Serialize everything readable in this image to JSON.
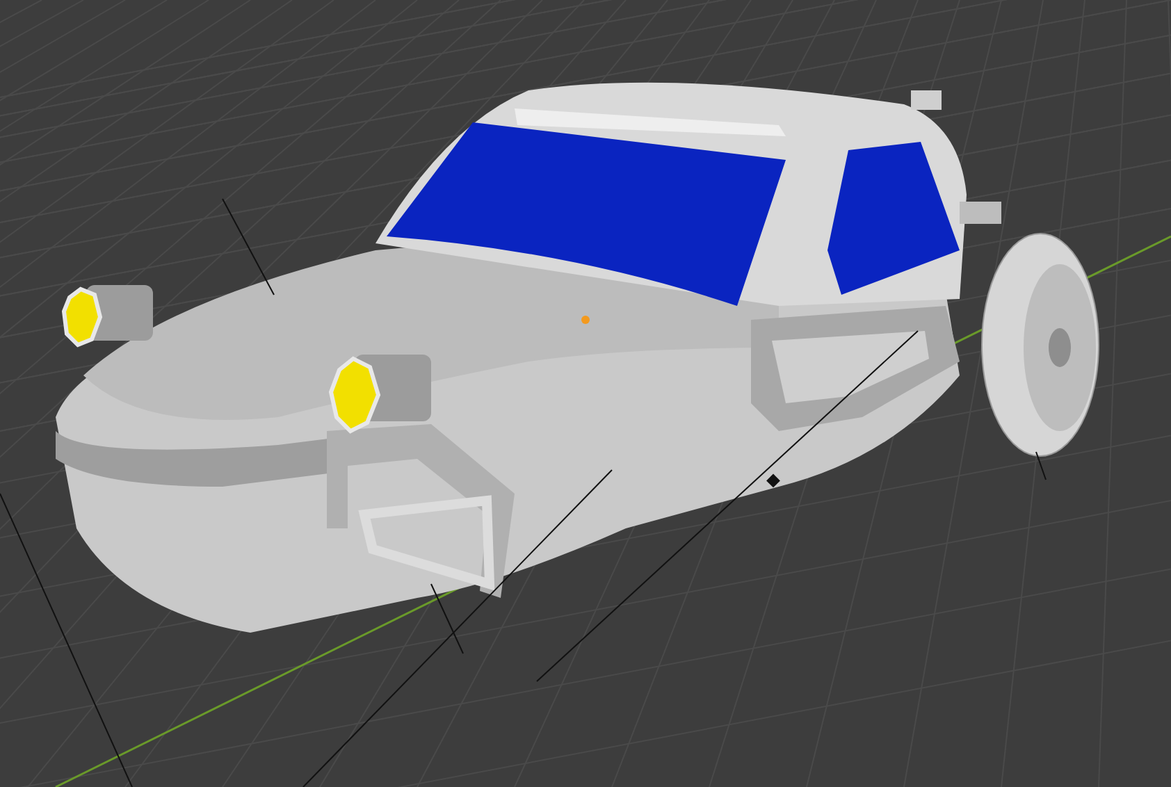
{
  "viewport": {
    "grid_visible": true,
    "axis_line_visible": true
  }
}
